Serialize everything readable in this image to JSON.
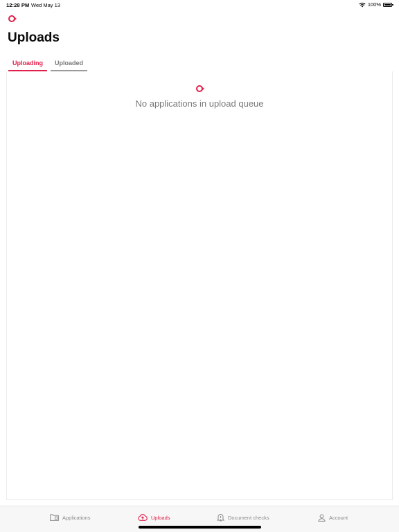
{
  "status_bar": {
    "time": "12:28 PM",
    "date": "Wed May 13",
    "battery": "100%"
  },
  "header": {
    "title": "Uploads"
  },
  "tabs": [
    {
      "label": "Uploading",
      "active": true
    },
    {
      "label": "Uploaded",
      "active": false
    }
  ],
  "empty_state": {
    "message": "No applications in upload queue"
  },
  "tab_bar": {
    "items": [
      {
        "label": "Applications",
        "icon": "folder-icon",
        "active": false
      },
      {
        "label": "Uploads",
        "icon": "cloud-upload-icon",
        "active": true
      },
      {
        "label": "Document checks",
        "icon": "bell-alert-icon",
        "active": false
      },
      {
        "label": "Account",
        "icon": "person-icon",
        "active": false
      }
    ]
  },
  "colors": {
    "accent": "#e0204a",
    "inactive": "#8a8a8a"
  }
}
